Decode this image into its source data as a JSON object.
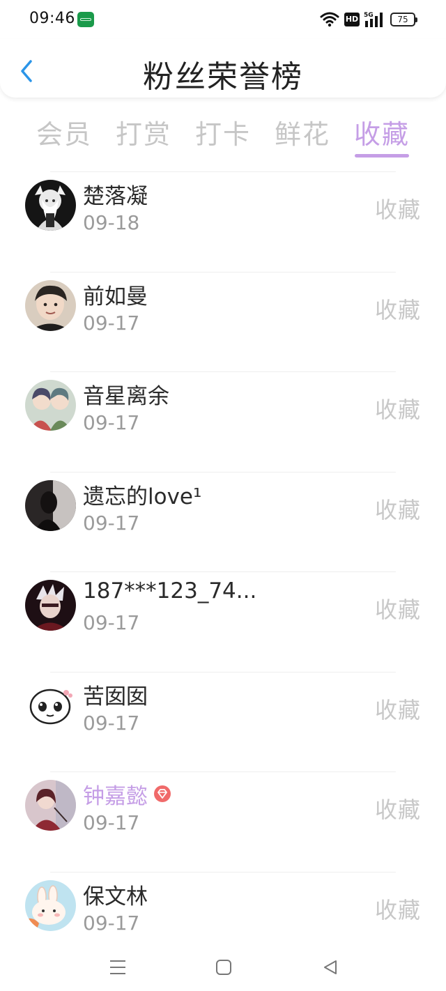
{
  "status_bar": {
    "time": "09:46",
    "app_badge_icon": "green-chat-app-icon",
    "hd_label": "HD",
    "signal_label": "5G",
    "battery": "75"
  },
  "header": {
    "title": "粉丝荣誉榜",
    "back_icon": "chevron-left-icon"
  },
  "tabs": [
    {
      "label": "会员",
      "active": false
    },
    {
      "label": "打赏",
      "active": false
    },
    {
      "label": "打卡",
      "active": false
    },
    {
      "label": "鲜花",
      "active": false
    },
    {
      "label": "收藏",
      "active": true
    }
  ],
  "colors": {
    "accent": "#c59ee6",
    "back_arrow": "#2b95e8",
    "name": "#2a2a2a",
    "date": "#9a9a9a",
    "action": "#c8c8c8",
    "vip_badge": "#f06a6a"
  },
  "fans": [
    {
      "name": "楚落凝",
      "date": "09-18",
      "action": "收藏",
      "vip": false,
      "avatar": "anime-white-hair-avatar"
    },
    {
      "name": "前如曼",
      "date": "09-17",
      "action": "收藏",
      "vip": false,
      "avatar": "boy-photo-avatar"
    },
    {
      "name": "音星离余",
      "date": "09-17",
      "action": "收藏",
      "vip": false,
      "avatar": "anime-pair-avatar"
    },
    {
      "name": "遗忘的love¹",
      "date": "09-17",
      "action": "收藏",
      "vip": false,
      "avatar": "dark-silhouette-avatar"
    },
    {
      "name": "187***123_74...",
      "date": "09-17",
      "action": "收藏",
      "vip": false,
      "avatar": "anime-dark-avatar"
    },
    {
      "name": "苦囡囡",
      "date": "09-17",
      "action": "收藏",
      "vip": false,
      "avatar": "sticker-face-avatar"
    },
    {
      "name": "钟嘉懿",
      "date": "09-17",
      "action": "收藏",
      "vip": true,
      "avatar": "anime-girl-red-avatar"
    },
    {
      "name": "保文林",
      "date": "09-17",
      "action": "收藏",
      "vip": false,
      "avatar": "cartoon-bunny-avatar"
    }
  ],
  "nav_bar": {
    "menu_icon": "menu-icon",
    "home_icon": "home-square-icon",
    "back_icon": "back-triangle-icon"
  }
}
